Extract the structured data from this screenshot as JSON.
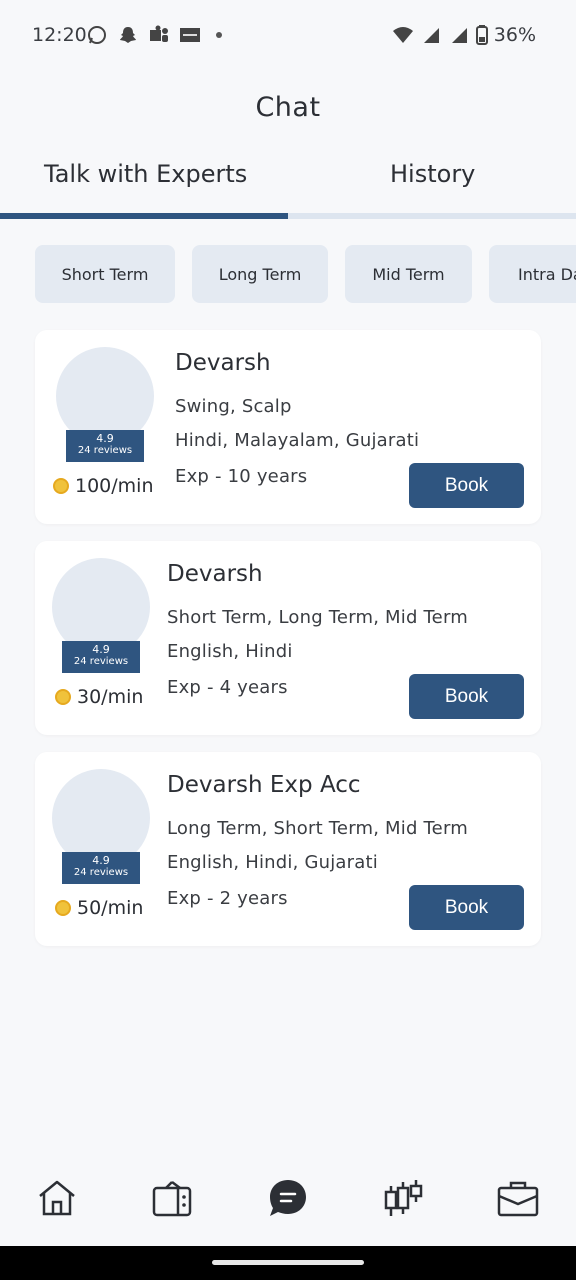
{
  "status_bar": {
    "time": "12:20",
    "battery": "36%",
    "left_icons": [
      "whatsapp-icon",
      "snapchat-icon",
      "teams-icon",
      "app-icon",
      "dot-icon"
    ],
    "right_icons": [
      "wifi-icon",
      "signal-icon",
      "signal-icon",
      "battery-icon"
    ]
  },
  "page": {
    "title": "Chat"
  },
  "tabs": [
    {
      "label": "Talk with Experts",
      "active": true
    },
    {
      "label": "History",
      "active": false
    }
  ],
  "filters": [
    "Short Term",
    "Long Term",
    "Mid Term",
    "Intra Da"
  ],
  "experts": [
    {
      "name": "Devarsh",
      "specialties": "Swing, Scalp",
      "languages": "Hindi, Malayalam, Gujarati",
      "experience": "Exp - 10 years",
      "rating": "4.9",
      "reviews": "24 reviews",
      "price": "100/min",
      "book_label": "Book"
    },
    {
      "name": "Devarsh",
      "specialties": "Short Term, Long Term, Mid Term",
      "languages": "English, Hindi",
      "experience": "Exp - 4 years",
      "rating": "4.9",
      "reviews": "24 reviews",
      "price": "30/min",
      "book_label": "Book"
    },
    {
      "name": "Devarsh Exp Acc",
      "specialties": "Long Term, Short Term, Mid Term",
      "languages": "English, Hindi, Gujarati",
      "experience": "Exp - 2 years",
      "rating": "4.9",
      "reviews": "24 reviews",
      "price": "50/min",
      "book_label": "Book"
    }
  ],
  "bottom_nav": [
    {
      "icon": "home-icon",
      "active": false
    },
    {
      "icon": "tv-icon",
      "active": false
    },
    {
      "icon": "chat-icon",
      "active": true
    },
    {
      "icon": "candlestick-chart-icon",
      "active": false
    },
    {
      "icon": "briefcase-icon",
      "active": false
    }
  ],
  "colors": {
    "accent": "#2f5580",
    "chip_bg": "#e4eaf2",
    "background": "#f7f8fa",
    "coin": "#f0c23b"
  }
}
